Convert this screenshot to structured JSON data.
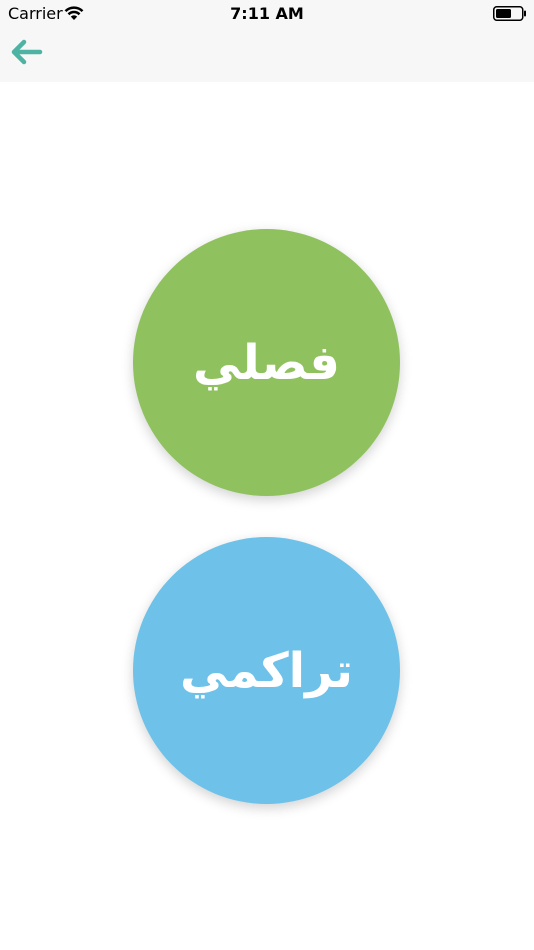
{
  "status_bar": {
    "carrier": "Carrier",
    "time": "7:11 AM",
    "wifi_icon": "wifi-icon",
    "battery_icon": "battery-icon"
  },
  "nav": {
    "back_icon": "arrow-left-icon",
    "accent_color": "#4fb3a4"
  },
  "options": [
    {
      "label": "فصلي",
      "color": "#8fc15f"
    },
    {
      "label": "تراكمي",
      "color": "#6ec1e8"
    }
  ]
}
